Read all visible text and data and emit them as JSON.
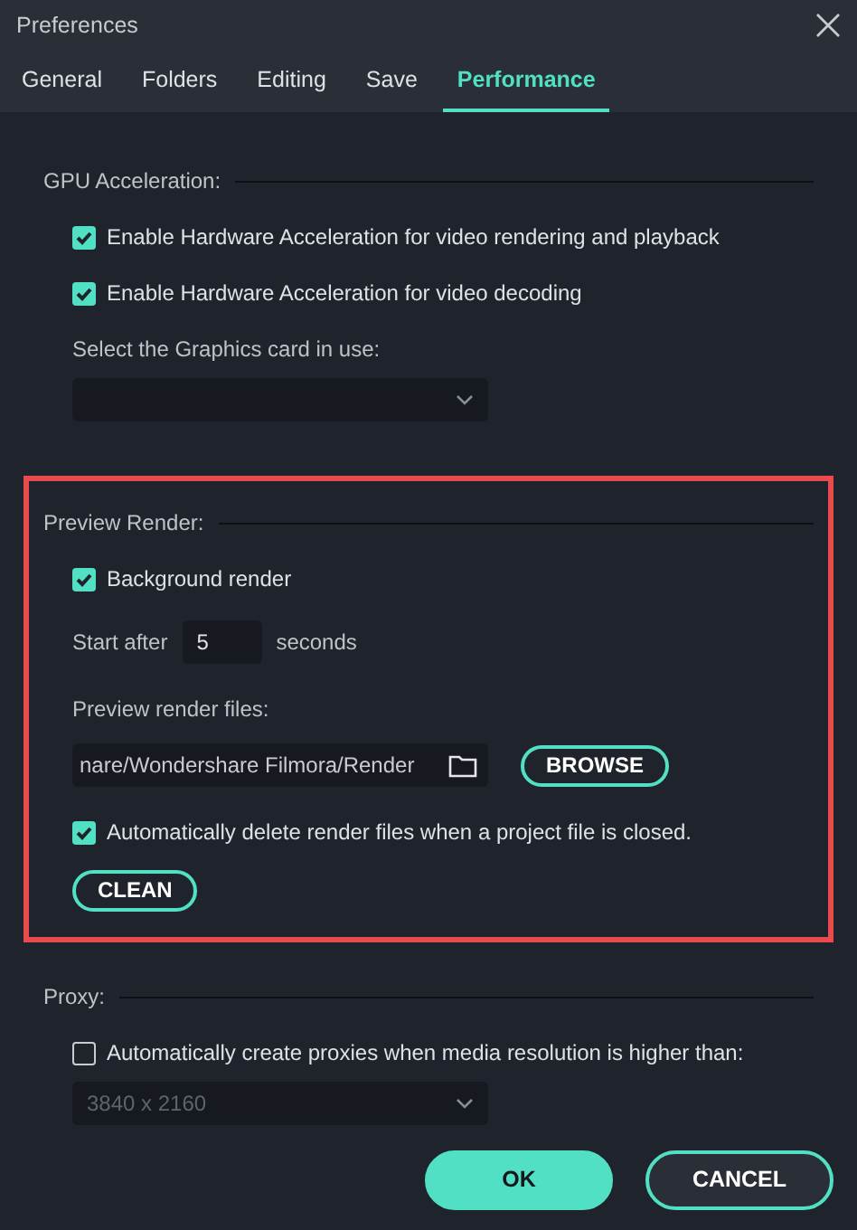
{
  "window": {
    "title": "Preferences"
  },
  "tabs": [
    {
      "label": "General",
      "selected": false
    },
    {
      "label": "Folders",
      "selected": false
    },
    {
      "label": "Editing",
      "selected": false
    },
    {
      "label": "Save",
      "selected": false
    },
    {
      "label": "Performance",
      "selected": true
    }
  ],
  "sections": [
    {
      "title": "GPU Acceleration:",
      "highlighted": false,
      "items": [
        {
          "kind": "checkbox",
          "label": "Enable Hardware Acceleration for video rendering and playback",
          "checked": true
        },
        {
          "kind": "checkbox",
          "label": "Enable Hardware Acceleration for video decoding",
          "checked": true
        },
        {
          "kind": "label",
          "text": "Select the Graphics card in use:"
        },
        {
          "kind": "select"
        }
      ]
    },
    {
      "title": "Preview Render:",
      "highlighted": true,
      "items": [
        {
          "kind": "checkbox",
          "label": "Background render",
          "checked": true
        },
        {
          "kind": "number",
          "before": "Start after",
          "value": "5",
          "after": "seconds"
        },
        {
          "kind": "label",
          "text": "Preview render files:"
        },
        {
          "kind": "path",
          "value": "nare/Wondershare Filmora/Render",
          "button": "BROWSE"
        },
        {
          "kind": "checkbox",
          "label": "Automatically delete render files when a project file is closed.",
          "checked": true
        },
        {
          "kind": "button",
          "label": "CLEAN"
        }
      ]
    },
    {
      "title": "Proxy:",
      "highlighted": false,
      "items": [
        {
          "kind": "checkbox",
          "label": "Automatically create proxies when media resolution is higher than:",
          "checked": false
        },
        {
          "kind": "select",
          "value": "3840 x 2160",
          "disabled": true
        }
      ]
    }
  ],
  "buttons": [
    {
      "label": "OK",
      "primary": true
    },
    {
      "label": "CANCEL",
      "primary": false
    }
  ]
}
